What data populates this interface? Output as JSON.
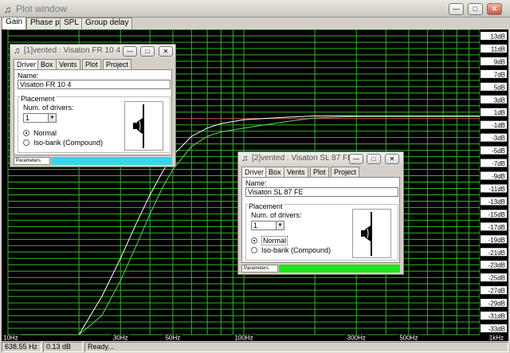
{
  "window": {
    "title": "Plot window",
    "icon": "speaker-icon"
  },
  "tabs": [
    "Gain",
    "Phase plot",
    "SPL",
    "Group delay"
  ],
  "active_tab": "Gain",
  "colors": {
    "plot_bg": "#000000",
    "grid": "#35b52b",
    "y_label_bg": "#ffffff",
    "curve_1": "#ffffff",
    "curve_2": "#5fd55a",
    "ref_line": "#c03050",
    "progress_1": "#38d6e6",
    "progress_2": "#26e01a"
  },
  "plot": {
    "y_axis": {
      "ticks": [
        "13dB",
        "11dB",
        "9dB",
        "7dB",
        "5dB",
        "3dB",
        "1dB",
        "-1dB",
        "-3dB",
        "-5dB",
        "-7dB",
        "-9dB",
        "-11dB",
        "-13dB",
        "-15dB",
        "-17dB",
        "-19dB",
        "-21dB",
        "-23dB",
        "-25dB",
        "-27dB",
        "-29dB",
        "-31dB",
        "-33dB"
      ],
      "range": [
        -34,
        14
      ]
    },
    "x_axis": {
      "ticks": [
        "10Hz",
        "30Hz",
        "50Hz",
        "100Hz",
        "300Hz",
        "500Hz",
        "1kHz"
      ],
      "tick_values": [
        10,
        30,
        50,
        100,
        300,
        500,
        1000
      ],
      "range": [
        10,
        1000
      ],
      "scale": "log"
    },
    "reference_level": 0,
    "curves": [
      {
        "x": [
          10,
          20,
          25,
          30,
          35,
          40,
          45,
          50,
          60,
          70,
          80,
          100,
          150,
          200,
          300,
          500,
          1000
        ],
        "y": [
          -34,
          -34,
          -28,
          -22,
          -16.5,
          -12,
          -8.5,
          -5.8,
          -2.8,
          -1.5,
          -0.8,
          -0.2,
          0.2,
          0.4,
          0.4,
          0.4,
          0.4
        ]
      },
      {
        "x": [
          10,
          20,
          25,
          30,
          35,
          40,
          45,
          50,
          60,
          70,
          80,
          100,
          150,
          200,
          300,
          500,
          1000
        ],
        "y": [
          -34,
          -34,
          -31,
          -25.5,
          -20,
          -15,
          -11,
          -8,
          -4.4,
          -2.8,
          -2.1,
          -1.5,
          -0.5,
          0.1,
          0.3,
          0.3,
          0.3
        ]
      }
    ]
  },
  "status": {
    "frequency": "638.55 Hz",
    "gain": "0.13 dB",
    "state": "Ready..."
  },
  "subwindows": [
    {
      "title": "[1]vented : Visaton FR 10 4",
      "tabs": [
        "Driver",
        "Box",
        "Vents",
        "Plot",
        "Project"
      ],
      "active_tab": "Driver",
      "name_label": "Name:",
      "name_value": "Visaton FR 10 4",
      "placement_label": "Placement",
      "num_drivers_label": "Num. of drivers:",
      "num_drivers_value": "1",
      "options": [
        "Normal",
        "Iso-barik (Compound)"
      ],
      "selected_option": "Normal",
      "footer_tab": "Parameters",
      "progress": 1.0
    },
    {
      "title": "[2]vented : Visaton SL 87 FE",
      "tabs": [
        "Driver",
        "Box",
        "Vents",
        "Plot",
        "Project"
      ],
      "active_tab": "Driver",
      "name_label": "Name:",
      "name_value": "Visaton SL 87 FE",
      "placement_label": "Placement",
      "num_drivers_label": "Num. of drivers:",
      "num_drivers_value": "1",
      "options": [
        "Normal",
        "Iso-barik (Compound)"
      ],
      "selected_option": "Normal",
      "footer_tab": "Parameters",
      "progress": 1.0
    }
  ]
}
